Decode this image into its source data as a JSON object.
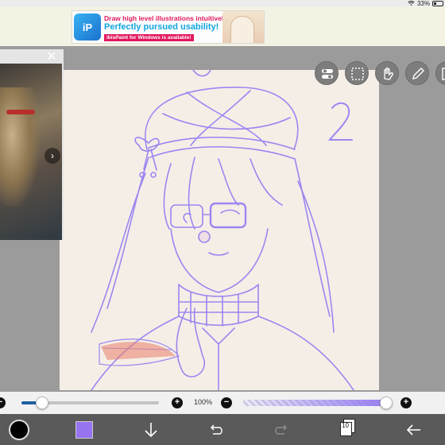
{
  "status_bar": {
    "battery": "33%"
  },
  "ad": {
    "logo_text": "iP",
    "line1": "Draw high level illustrations intuitively!",
    "line2": "Perfectly pursued usability!",
    "line3": "ibisPaint for Windows is available!"
  },
  "canvas": {
    "annotation": "2",
    "stroke_color": "#9b86f0",
    "background": "#f5eee7"
  },
  "reference_window": {
    "close_icon": "close-icon",
    "next_icon": "chevron-right-icon"
  },
  "tools": [
    "toggle-icon",
    "selection-icon",
    "hand-icon",
    "pen-icon",
    "save-icon"
  ],
  "sliders": {
    "size_minus": "−",
    "size_plus": "+",
    "size_value": 0.15,
    "opacity_label": "100%",
    "opacity_minus": "−",
    "opacity_plus": "+",
    "opacity_value": 1.0
  },
  "bottom_bar": {
    "color": "#9774f2",
    "layer_count": "10",
    "icons": [
      "brush-icon",
      "color-swatch",
      "down-arrow-icon",
      "undo-icon",
      "redo-icon",
      "layers-icon",
      "back-icon"
    ]
  }
}
